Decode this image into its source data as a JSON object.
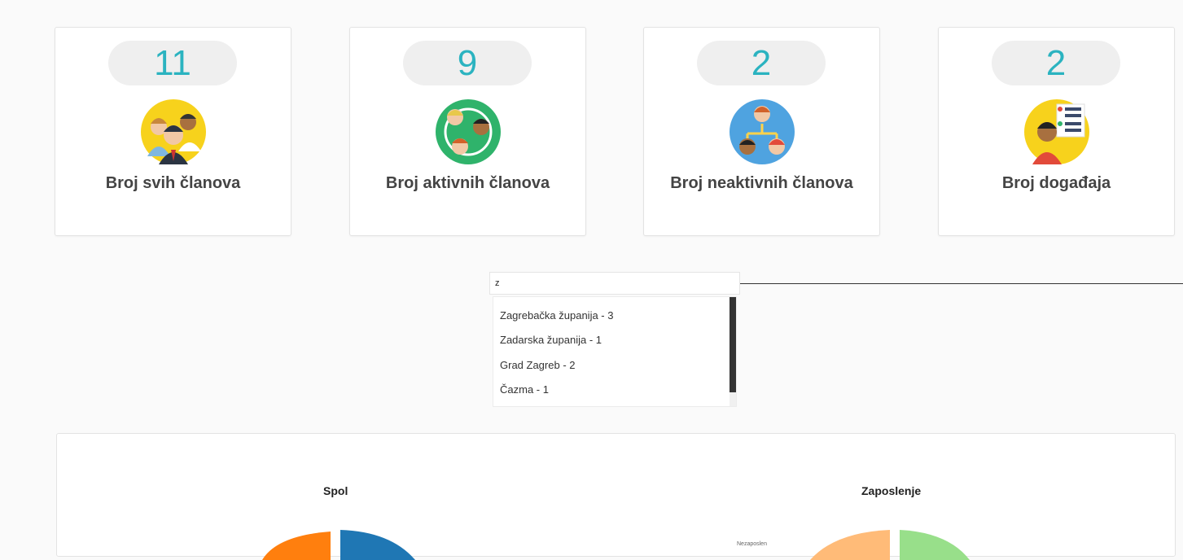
{
  "stats": [
    {
      "count": "11",
      "label": "Broj svih članova",
      "icon": "group-people-icon"
    },
    {
      "count": "9",
      "label": "Broj aktivnih članova",
      "icon": "active-members-icon"
    },
    {
      "count": "2",
      "label": "Broj neaktivnih članova",
      "icon": "org-chart-people-icon"
    },
    {
      "count": "2",
      "label": "Broj događaja",
      "icon": "events-list-icon"
    }
  ],
  "search": {
    "value": "z"
  },
  "suggestions": [
    "Zagrebačka županija - 3",
    "Zadarska županija - 1",
    "Grad Zagreb - 2",
    "Čazma - 1"
  ],
  "charts": {
    "gender_title": "Spol",
    "employment_title": "Zaposlenje",
    "employment_partial_label": "Nezaposlen"
  },
  "colors": {
    "accent": "#2bb3c0",
    "orange": "#ff7f0e",
    "blue": "#1f77b4",
    "peach": "#ffbb78",
    "green": "#98df8a"
  }
}
